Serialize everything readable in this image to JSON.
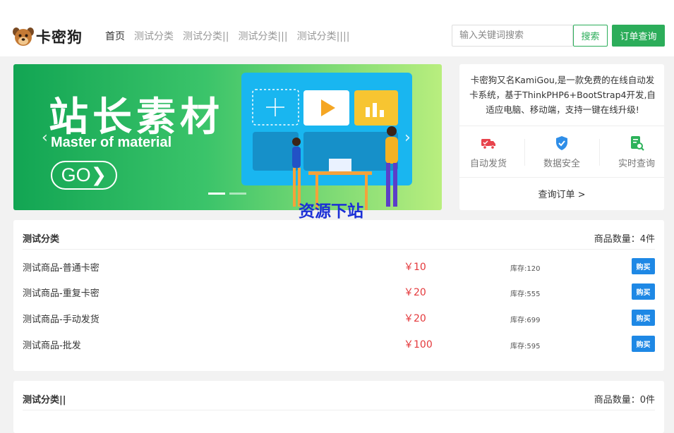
{
  "header": {
    "logo_text": "卡密狗",
    "nav": [
      {
        "label": "首页"
      },
      {
        "label": "测试分类"
      },
      {
        "label": "测试分类||"
      },
      {
        "label": "测试分类|||"
      },
      {
        "label": "测试分类||||"
      }
    ],
    "search_placeholder": "输入关键词搜索",
    "search_button": "搜索",
    "order_button": "订单查询"
  },
  "banner": {
    "title": "站长素材",
    "subtitle": "Master of material",
    "go_label": "GO❯",
    "prev_arrow": "‹",
    "next_arrow": "›"
  },
  "info": {
    "description": "卡密狗又名KamiGou,是一款免费的在线自动发卡系统，基于ThinkPHP6+BootStrap4开发,自适应电脑、移动端，支持一键在线升级!",
    "features": [
      {
        "label": "自动发货",
        "icon": "truck-icon",
        "color": "#e8434c"
      },
      {
        "label": "数据安全",
        "icon": "shield-icon",
        "color": "#2f8ee8"
      },
      {
        "label": "实时查询",
        "icon": "search-doc-icon",
        "color": "#2cb25a"
      }
    ],
    "query_link": "查询订单 >"
  },
  "watermark": "资源下站",
  "categories": [
    {
      "title": "测试分类",
      "count": "商品数量：4件",
      "products": [
        {
          "name": "测试商品-普通卡密",
          "price": "￥10",
          "stock": "库存:120",
          "buy": "购买"
        },
        {
          "name": "测试商品-重复卡密",
          "price": "￥20",
          "stock": "库存:555",
          "buy": "购买"
        },
        {
          "name": "测试商品-手动发货",
          "price": "￥20",
          "stock": "库存:699",
          "buy": "购买"
        },
        {
          "name": "测试商品-批发",
          "price": "￥100",
          "stock": "库存:595",
          "buy": "购买"
        }
      ]
    },
    {
      "title": "测试分类||",
      "count": "商品数量：0件",
      "products": []
    }
  ],
  "colors": {
    "brand_green": "#2cad5a",
    "price_red": "#e4393c",
    "buy_blue": "#1e88e5",
    "watermark_blue": "#1b2fd6"
  }
}
